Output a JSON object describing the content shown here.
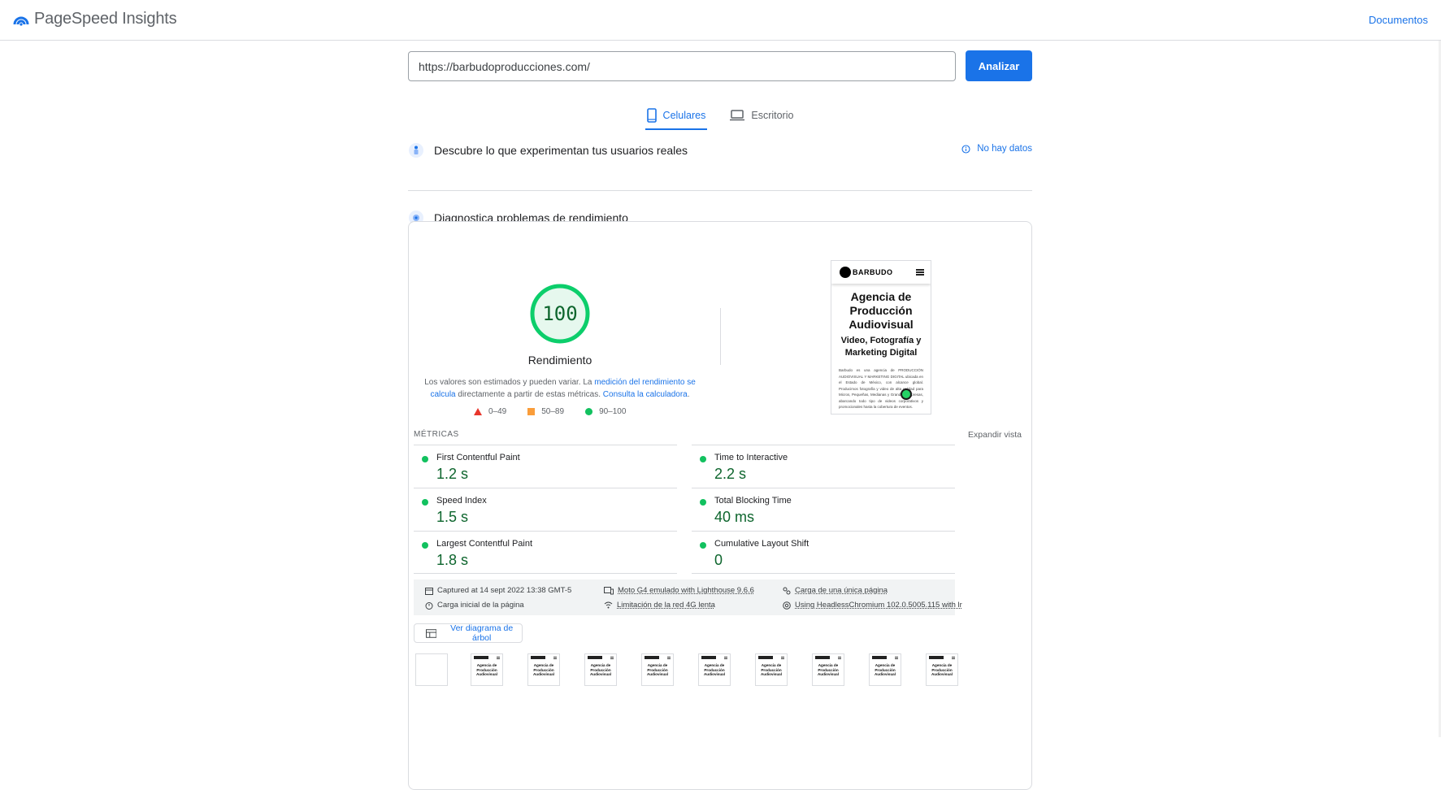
{
  "header": {
    "app_title": "PageSpeed Insights",
    "docs_link": "Documentos"
  },
  "url_bar": {
    "value": "https://barbudoproducciones.com/",
    "analyze_label": "Analizar"
  },
  "tabs": [
    {
      "label": "Celulares",
      "active": true
    },
    {
      "label": "Escritorio",
      "active": false
    }
  ],
  "field_section": {
    "title": "Descubre lo que experimentan tus usuarios reales",
    "status": "No hay datos"
  },
  "lab_section": {
    "title": "Diagnostica problemas de rendimiento"
  },
  "score": {
    "value": "100",
    "fraction": 1.0,
    "label": "Rendimiento",
    "desc_1": "Los valores son estimados y pueden variar. La ",
    "desc_link_1": "medición del rendimiento se calcula",
    "desc_2": " directamente a partir de estas métricas. ",
    "desc_link_2": "Consulta la calculadora",
    "desc_3": "."
  },
  "legend": [
    {
      "label": "0–49",
      "shape": "triangle",
      "color": "#e8362c"
    },
    {
      "label": "50–89",
      "shape": "square",
      "color": "#fa9d3a"
    },
    {
      "label": "90–100",
      "shape": "circle",
      "color": "#12c15f"
    }
  ],
  "preview": {
    "brand": "BARBUDO",
    "heading": "Agencia de Producción Audiovisual",
    "subheading": "Video, Fotografía y Marketing Digital",
    "body": "Barbudo es una agencia de PRODUCCIÓN AUDIOVISUAL Y MARKETING DIGITAL ubicada en el Estado de México, con alcance global. Producimos fotografía y video de alta calidad para Micros, Pequeñas, Medianas y Grandes Empresas, abarcando todo tipo de videos corporativos y promocionales hasta la cobertura de eventos."
  },
  "metrics": {
    "header": "MÉTRICAS",
    "expand": "Expandir vista",
    "items": [
      {
        "name": "First Contentful Paint",
        "value": "1.2 s"
      },
      {
        "name": "Time to Interactive",
        "value": "2.2 s"
      },
      {
        "name": "Speed Index",
        "value": "1.5 s"
      },
      {
        "name": "Total Blocking Time",
        "value": "40 ms"
      },
      {
        "name": "Largest Contentful Paint",
        "value": "1.8 s"
      },
      {
        "name": "Cumulative Layout Shift",
        "value": "0"
      }
    ]
  },
  "info": {
    "captured": "Captured at 14 sept 2022 13:38 GMT-5",
    "device": "Moto G4 emulado with Lighthouse 9.6.6",
    "load_type": "Carga de una única página",
    "initial_load": "Carga inicial de la página",
    "network": "Limitación de la red 4G lenta",
    "browser": "Using HeadlessChromium 102.0.5005.115 with lr"
  },
  "tree_button": "Ver diagrama de árbol",
  "thumb_text": "Agencia de Producción Audiovisual",
  "colors": {
    "accent": "#1a73e8",
    "pass": "#0cce6b",
    "pass_text": "#0d652d"
  }
}
